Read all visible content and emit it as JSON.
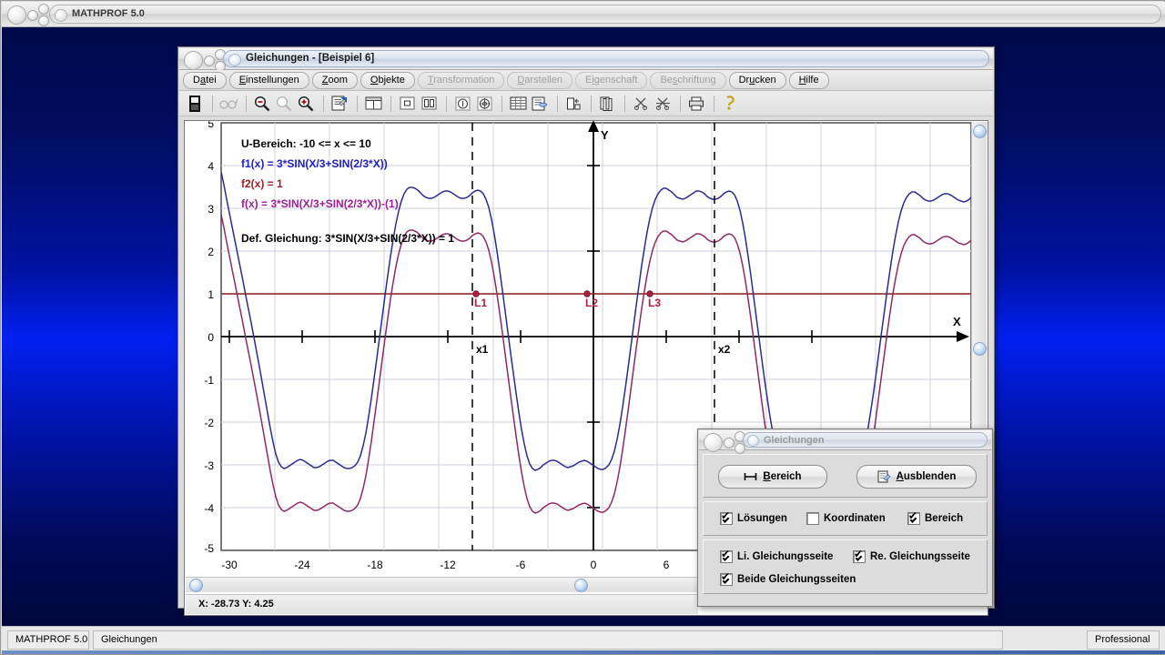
{
  "app": {
    "title": "MATHPROF 5.0"
  },
  "taskbar": {
    "app_cell": "MATHPROF 5.0",
    "doc_cell": "Gleichungen",
    "edition_cell": "Professional"
  },
  "child_window": {
    "title": "Gleichungen - [Beispiel 6]"
  },
  "menu": {
    "items": [
      {
        "label": "Datei",
        "accel": "a",
        "disabled": false,
        "name": "menu-datei"
      },
      {
        "label": "Einstellungen",
        "accel": "E",
        "disabled": false,
        "name": "menu-einstellungen"
      },
      {
        "label": "Zoom",
        "accel": "Z",
        "disabled": false,
        "name": "menu-zoom"
      },
      {
        "label": "Objekte",
        "accel": "O",
        "disabled": false,
        "name": "menu-objekte"
      },
      {
        "label": "Transformation",
        "accel": "T",
        "disabled": true,
        "name": "menu-transformation"
      },
      {
        "label": "Darstellen",
        "accel": "D",
        "disabled": true,
        "name": "menu-darstellen"
      },
      {
        "label": "Eigenschaft",
        "accel": "i",
        "disabled": true,
        "name": "menu-eigenschaft"
      },
      {
        "label": "Beschriftung",
        "accel": "s",
        "disabled": true,
        "name": "menu-beschriftung"
      },
      {
        "label": "Drucken",
        "accel": "u",
        "disabled": false,
        "name": "menu-drucken"
      },
      {
        "label": "Hilfe",
        "accel": "H",
        "disabled": false,
        "name": "menu-hilfe"
      }
    ]
  },
  "toolbar": {
    "buttons": [
      {
        "icon": "calculator-icon",
        "enabled": true
      },
      {
        "sep": true
      },
      {
        "icon": "glasses-icon",
        "enabled": false
      },
      {
        "sep": true
      },
      {
        "icon": "zoom-out-icon",
        "enabled": true
      },
      {
        "icon": "zoom-reset-icon",
        "enabled": false
      },
      {
        "icon": "zoom-in-icon",
        "enabled": true
      },
      {
        "sep": true
      },
      {
        "icon": "properties-icon",
        "enabled": true
      },
      {
        "sep": true
      },
      {
        "icon": "window-layout-icon",
        "enabled": true
      },
      {
        "sep": true
      },
      {
        "icon": "single-pane-icon",
        "enabled": true
      },
      {
        "icon": "split-pane-icon",
        "enabled": true
      },
      {
        "sep": true
      },
      {
        "icon": "info-circle-icon",
        "enabled": true
      },
      {
        "icon": "target-circle-icon",
        "enabled": true
      },
      {
        "sep": true
      },
      {
        "icon": "table-icon",
        "enabled": true
      },
      {
        "icon": "report-icon",
        "enabled": true
      },
      {
        "sep": true
      },
      {
        "icon": "export-icon",
        "enabled": true
      },
      {
        "sep": true
      },
      {
        "icon": "copy-pages-icon",
        "enabled": true
      },
      {
        "sep": true
      },
      {
        "icon": "scissors-icon",
        "enabled": true
      },
      {
        "icon": "scissors-cross-icon",
        "enabled": true
      },
      {
        "sep": true
      },
      {
        "icon": "printer-icon",
        "enabled": true
      },
      {
        "sep": true
      },
      {
        "icon": "help-key-icon",
        "enabled": true
      }
    ]
  },
  "plot": {
    "annotations": {
      "range_label": "U-Bereich: -10 <= x <= 10",
      "f1_label": "f1(x) = 3*SIN(X/3+SIN(2/3*X))",
      "f2_label": "f2(x) = 1",
      "f_label": "f(x) = 3*SIN(X/3+SIN(2/3*X))-(1)",
      "def_label": "Def. Gleichung: 3*SIN(X/3+SIN(2/3*X)) = 1"
    },
    "axis_names": {
      "x": "X",
      "y": "Y"
    },
    "solution_labels": [
      "L1",
      "L2",
      "L3"
    ],
    "bound_labels": [
      "x1",
      "x2"
    ],
    "coordinates": "X: -28.73    Y: 4.25"
  },
  "chart_data": {
    "type": "line",
    "title": "Gleichungen - Beispiel 6",
    "xlabel": "X",
    "ylabel": "Y",
    "xlim": [
      -31.5,
      8.5
    ],
    "ylim": [
      -5,
      5
    ],
    "xticks": [
      -30,
      -24,
      -18,
      -12,
      -6,
      0,
      6
    ],
    "yticks": [
      5,
      4,
      3,
      2,
      1,
      0,
      -1,
      -2,
      -3,
      -4,
      -5
    ],
    "grid": true,
    "legend": "inline-annotations",
    "series": [
      {
        "name": "f1(x) = 3*SIN(X/3+SIN(2/3*X))",
        "color": "#2b2b8f",
        "expression": "3*sin(x/3+sin(2/3*x))"
      },
      {
        "name": "f(x) = 3*SIN(X/3+SIN(2/3*X))-(1)",
        "color": "#8e2a62",
        "expression": "3*sin(x/3+sin(2/3*x))-1"
      },
      {
        "name": "f2(x) = 1",
        "color": "#8b1a1a",
        "expression": "1"
      }
    ],
    "solution_markers": [
      {
        "label": "L1",
        "x": -9.6,
        "y": 1
      },
      {
        "label": "L2",
        "x": -0.55,
        "y": 1
      },
      {
        "label": "L3",
        "x": 4.6,
        "y": 1
      }
    ],
    "range_bounds": [
      {
        "label": "x1",
        "x": -10
      },
      {
        "label": "x2",
        "x": 10
      }
    ],
    "defining_equation": "3*SIN(X/3+SIN(2/3*X)) = 1",
    "domain_restriction": "-10 <= x <= 10"
  },
  "dialog": {
    "title": "Gleichungen",
    "buttons": [
      {
        "label": "Bereich",
        "accel": "B",
        "icon": "range-icon",
        "name": "bereich-button"
      },
      {
        "label": "Ausblenden",
        "accel": "A",
        "icon": "hide-icon",
        "name": "ausblenden-button"
      }
    ],
    "checkbox_row1": [
      {
        "label": "Lösungen",
        "checked": true,
        "name": "checkbox-loesungen"
      },
      {
        "label": "Koordinaten",
        "checked": false,
        "name": "checkbox-koordinaten"
      },
      {
        "label": "Bereich",
        "checked": true,
        "name": "checkbox-bereich"
      }
    ],
    "checkbox_row2": [
      {
        "label": "Li. Gleichungsseite",
        "checked": true,
        "name": "checkbox-li-gleichungsseite"
      },
      {
        "label": "Re. Gleichungsseite",
        "checked": true,
        "name": "checkbox-re-gleichungsseite"
      }
    ],
    "checkbox_row3": [
      {
        "label": "Beide Gleichungsseiten",
        "checked": true,
        "name": "checkbox-beide-gleichungsseiten"
      }
    ]
  },
  "colors": {
    "desktop_blue": "#0020f0",
    "curve_blue": "#2b2b8f",
    "curve_magenta": "#8e2a62",
    "line_red": "#8b1a1a",
    "grid": "#c8c8d8",
    "chrome": "#dcdcdc"
  }
}
